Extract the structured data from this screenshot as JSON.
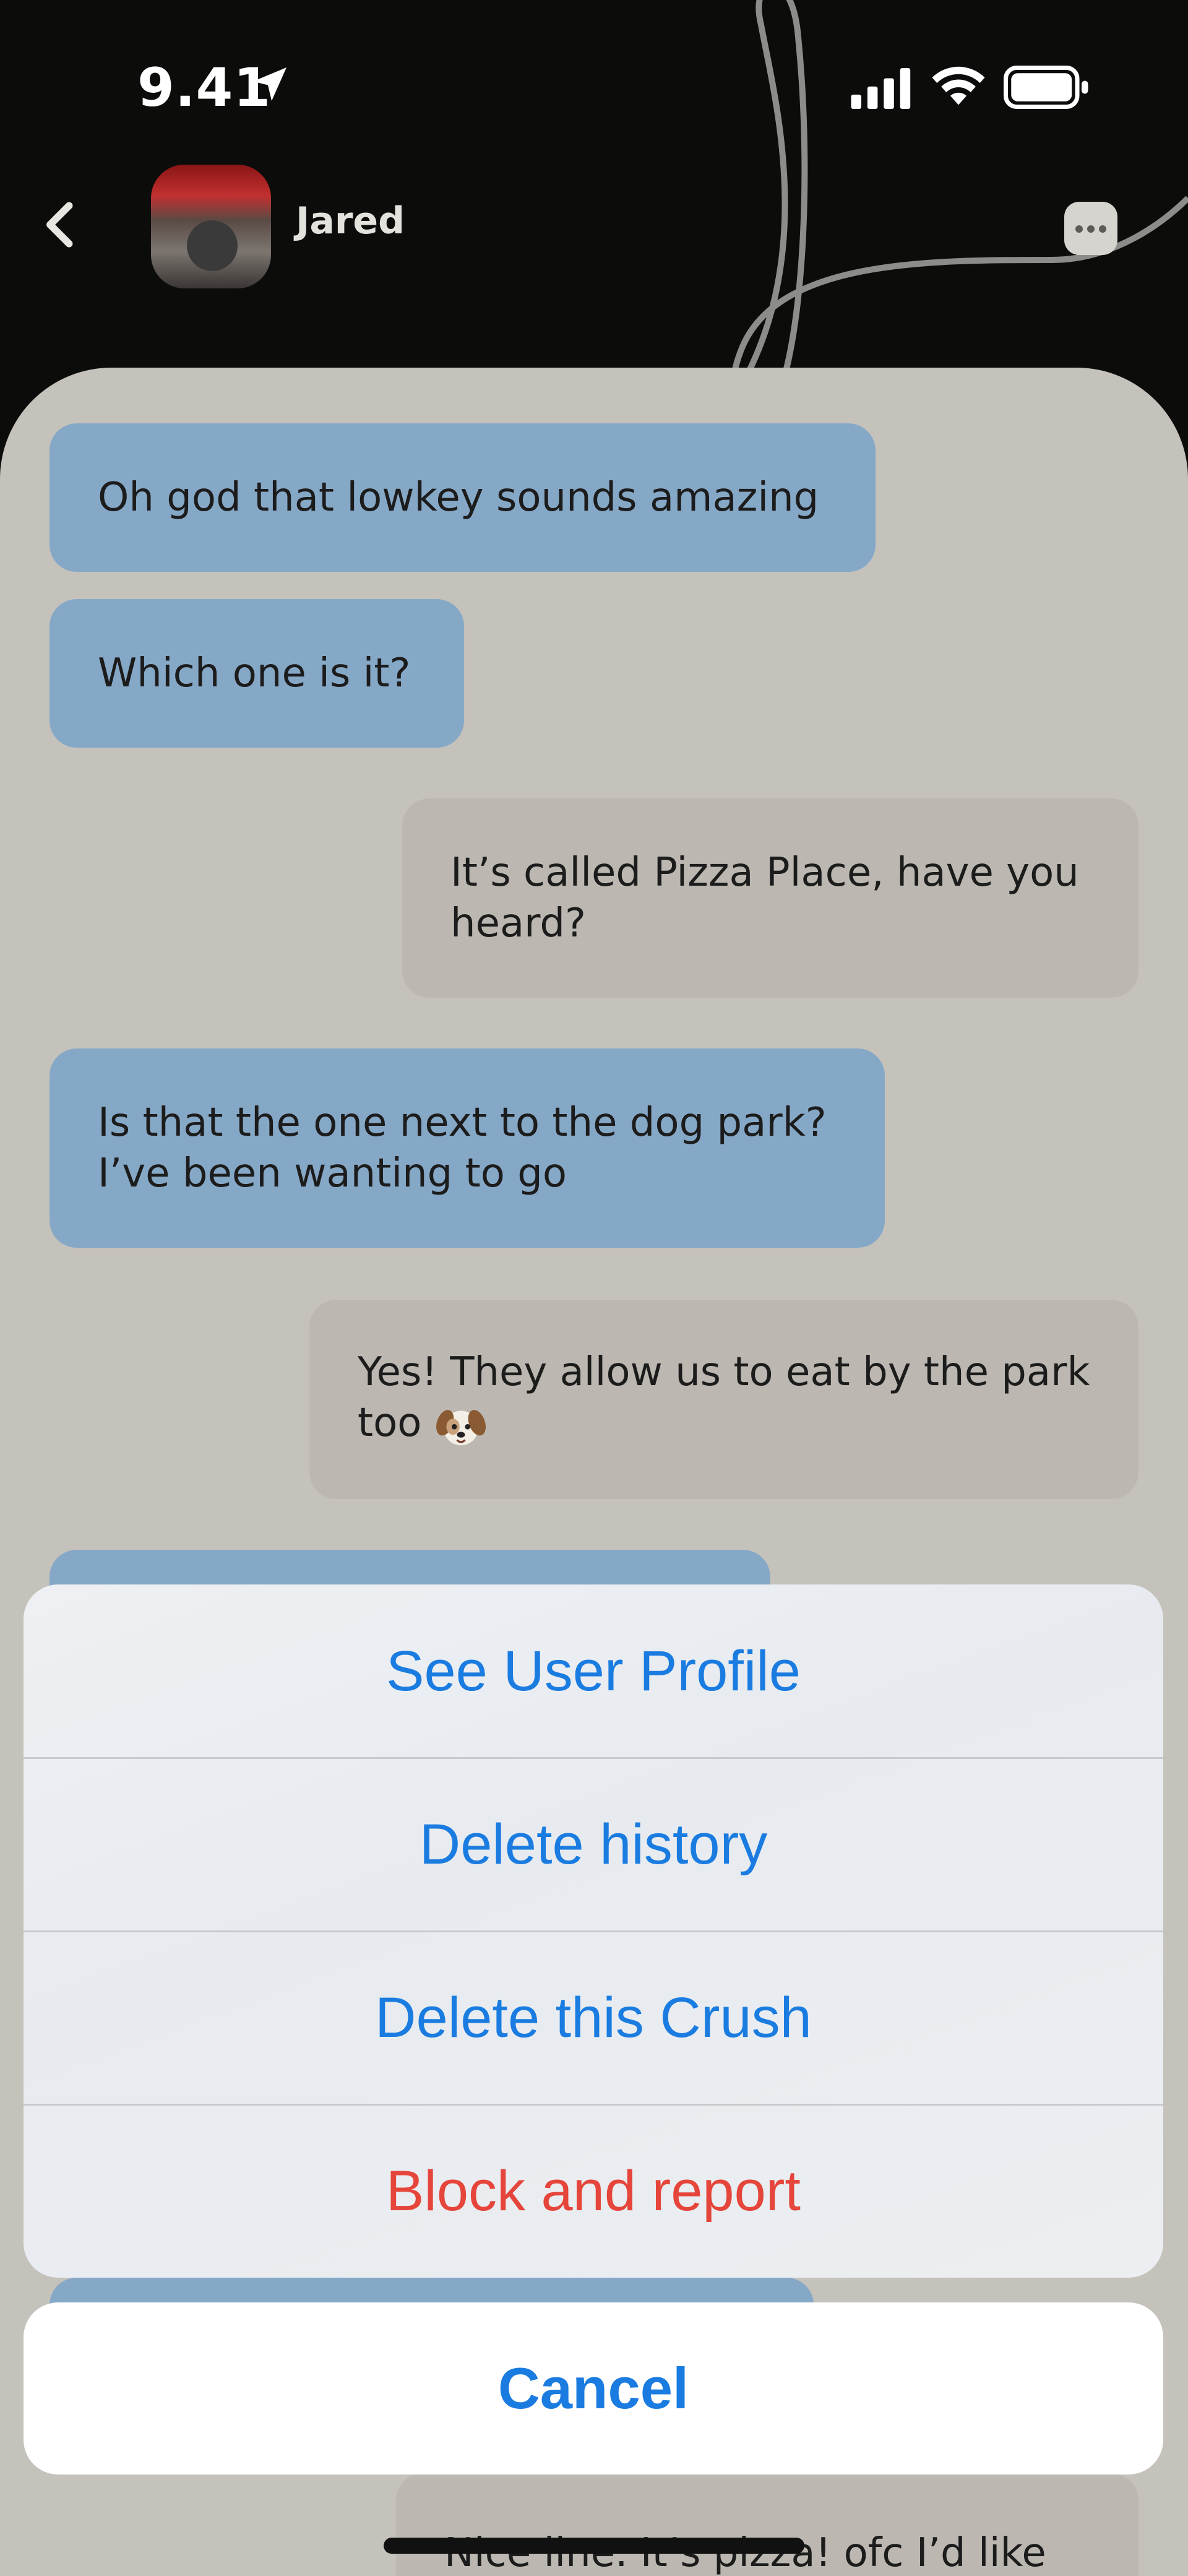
{
  "status_bar": {
    "time": "9.41"
  },
  "header": {
    "contact_name": "Jared"
  },
  "messages": [
    {
      "side": "in",
      "text": "Oh god that lowkey sounds amazing"
    },
    {
      "side": "in",
      "text": "Which one is it?"
    },
    {
      "side": "out",
      "text": "It’s called Pizza Place, have you heard?"
    },
    {
      "side": "in",
      "text": "Is that the one next to the dog park? I’ve been wanting to go"
    },
    {
      "side": "out",
      "text": "Yes! They allow us to eat by the park too"
    },
    {
      "side": "in",
      "text": ""
    },
    {
      "side": "in",
      "text": ""
    },
    {
      "side": "out",
      "text": "Nice line. It’s pizza! ofc I’d like to"
    }
  ],
  "action_sheet": {
    "actions": [
      {
        "label": "See User Profile",
        "style": "default"
      },
      {
        "label": "Delete history",
        "style": "default"
      },
      {
        "label": "Delete this Crush",
        "style": "default"
      },
      {
        "label": "Block and report",
        "style": "destructive"
      }
    ],
    "cancel_label": "Cancel"
  },
  "colors": {
    "accent": "#1a7ce0",
    "destructive": "#e5453a",
    "incoming_bubble": "#86a8c7",
    "outgoing_bubble": "#bcb8b1",
    "chat_background": "#c5c2bc",
    "header_background": "#0c0c0b"
  }
}
